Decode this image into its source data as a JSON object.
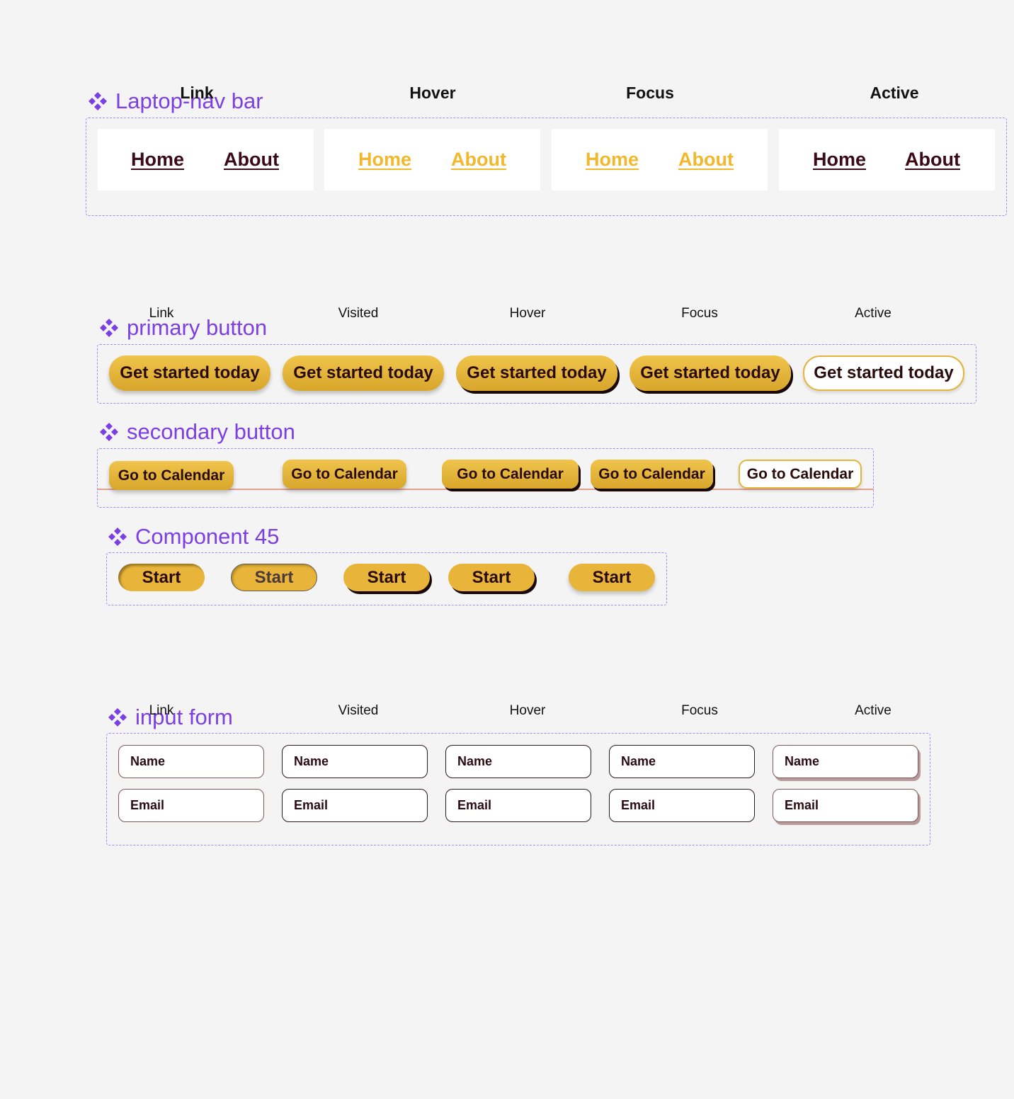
{
  "colors": {
    "accent_purple": "#7b3fe4",
    "gold": "#e8b53a",
    "dark_maroon": "#3a0b16",
    "background": "#f4f4f4"
  },
  "nav_section": {
    "title": "Laptop-nav bar",
    "states": [
      "Link",
      "Hover",
      "Focus",
      "Active"
    ],
    "home_label": "Home",
    "about_label": "About"
  },
  "primary_section": {
    "title": "primary button",
    "states": [
      "Link",
      "Visited",
      "Hover",
      "Focus",
      "Active"
    ],
    "button_label": "Get started today"
  },
  "secondary_section": {
    "title": "secondary button",
    "button_label": "Go to Calendar"
  },
  "component45_section": {
    "title": "Component 45",
    "button_label": "Start"
  },
  "input_section": {
    "title": "input form",
    "states": [
      "Link",
      "Visited",
      "Hover",
      "Focus",
      "Active"
    ],
    "name_label": "Name",
    "email_label": "Email"
  }
}
